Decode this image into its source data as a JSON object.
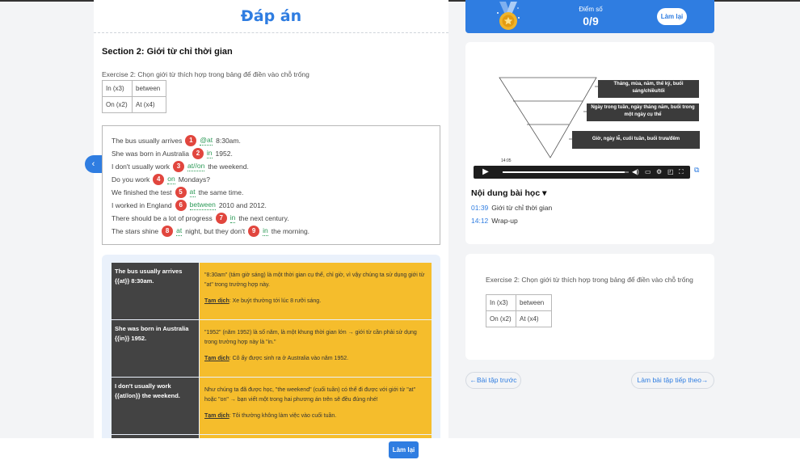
{
  "header": {
    "title": "Đáp án"
  },
  "section": {
    "title": "Section 2: Giới từ chỉ thời gian"
  },
  "exercise": {
    "instruction": "Exercise 2: Chọn giới từ thích hợp trong bảng để điền vào chỗ trống",
    "wordbank": [
      [
        "In (x3)",
        "between"
      ],
      [
        "On (x2)",
        "At (x4)"
      ]
    ]
  },
  "answers": [
    {
      "parts": [
        {
          "t": "The bus usually arrives"
        },
        {
          "n": "1"
        },
        {
          "a": "@at"
        },
        {
          "t": "8:30am."
        }
      ]
    },
    {
      "parts": [
        {
          "t": "She was born in Australia"
        },
        {
          "n": "2"
        },
        {
          "a": "in"
        },
        {
          "t": "1952."
        }
      ]
    },
    {
      "parts": [
        {
          "t": "I don't usually work"
        },
        {
          "n": "3"
        },
        {
          "a": "at//on"
        },
        {
          "t": "the weekend."
        }
      ]
    },
    {
      "parts": [
        {
          "t": "Do you work"
        },
        {
          "n": "4"
        },
        {
          "a": "on"
        },
        {
          "t": "Mondays?"
        }
      ]
    },
    {
      "parts": [
        {
          "t": "We finished the test"
        },
        {
          "n": "5"
        },
        {
          "a": "at"
        },
        {
          "t": "the same time."
        }
      ]
    },
    {
      "parts": [
        {
          "t": "I worked in England"
        },
        {
          "n": "6"
        },
        {
          "a": "between"
        },
        {
          "t": "2010 and 2012."
        }
      ]
    },
    {
      "parts": [
        {
          "t": "There should be a lot of progress"
        },
        {
          "n": "7"
        },
        {
          "a": "in"
        },
        {
          "t": "the next century."
        }
      ]
    },
    {
      "parts": [
        {
          "t": "The stars shine"
        },
        {
          "n": "8"
        },
        {
          "a": "at"
        },
        {
          "t": "night, but they don't"
        },
        {
          "n": "9"
        },
        {
          "a": "in"
        },
        {
          "t": "the morning."
        }
      ]
    }
  ],
  "explanations": [
    {
      "question": "The bus usually arrives {{at}} 8:30am.",
      "explanation": "\"8:30am\" (tám giờ sáng) là một thời gian cụ thể, chỉ giờ, vì vậy chúng ta sử dụng giới từ \"at\" trong trường hợp này.",
      "translation_label": "Tạm dịch",
      "translation": ": Xe buýt thường tới lúc 8 rưỡi sáng."
    },
    {
      "question": "She was born in Australia {{in}} 1952.",
      "explanation": "\"1952\" (năm 1952) là số năm, là một khung thời gian lớn → giới từ cần phải sử dụng trong trường hợp này là \"in.\"",
      "translation_label": "Tạm dịch",
      "translation": ": Cô ấy được sinh ra ở Australia vào năm 1952."
    },
    {
      "question": "I don't usually work {{at//on}} the weekend.",
      "explanation": "Như chúng ta đã được học, \"the weekend\" (cuối tuần) có thể đi được với giới từ \"at\" hoặc \"on\" → bạn viết một trong hai phương án trên sẽ đều đúng nhé!",
      "translation_label": "Tạm dịch",
      "translation": ": Tôi thường không làm việc vào cuối tuần."
    }
  ],
  "score": {
    "label": "Điểm số",
    "value": "0/9",
    "retry": "Làm lại"
  },
  "video": {
    "pyramid": [
      "Tháng, mùa, năm, thế kỷ, buổi sáng/chiều/tối",
      "Ngày trong tuần, ngày tháng năm, buổi trong một ngày cụ thể",
      "Giờ, ngày lễ, cuối tuần, buổi trưa/đêm"
    ],
    "timestamp": "14:05",
    "progress": 0.97,
    "icons": {
      "play": "play-icon",
      "volume": "volume-icon",
      "captions": "captions-icon",
      "settings": "gear-icon",
      "miniplayer": "miniplayer-icon",
      "fullscreen": "fullscreen-icon"
    }
  },
  "lesson": {
    "title": "Nội dung bài học",
    "items": [
      {
        "time": "01:39",
        "label": "Giới từ chỉ thời gian"
      },
      {
        "time": "14:12",
        "label": "Wrap-up"
      }
    ]
  },
  "nav": {
    "prev": "←Bài tập trước",
    "next": "Làm bài tập tiếp theo→"
  },
  "bottom": {
    "retry": "Làm lại"
  },
  "colors": {
    "accent": "#2f7de1",
    "answer": "#2c9a57",
    "badge": "#e1463e",
    "explanation_bg": "#f5bd2c",
    "question_bg": "#434343"
  }
}
